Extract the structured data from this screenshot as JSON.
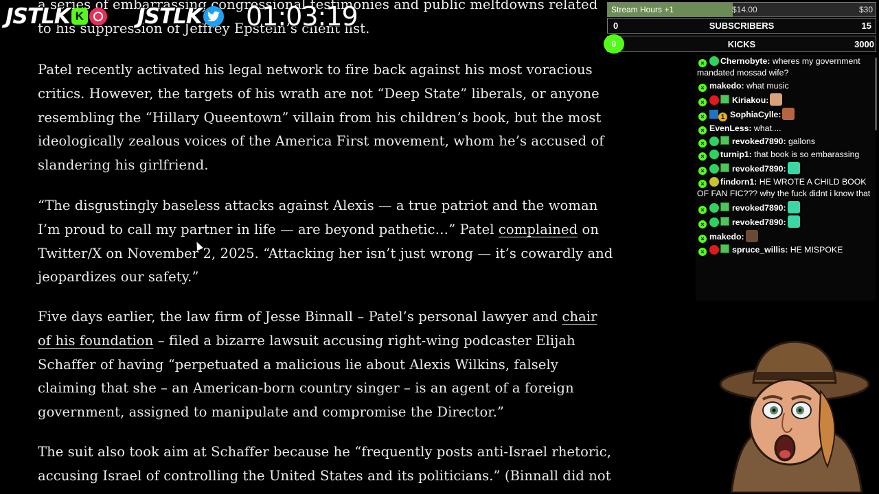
{
  "overlay": {
    "logo1": "JSTLK",
    "logo2": "JSTLK",
    "kick_badge": "K",
    "timer": "01:03:19"
  },
  "goals": {
    "stream_hours_label": "Stream Hours +1",
    "stream_hours_amount": "$14.00",
    "stream_hours_goal": "$30",
    "stream_hours_progress": 0.466,
    "subs_count": "0",
    "subs_label": "SUBSCRIBERS",
    "subs_goal": "15",
    "kicks_count": "0",
    "kicks_label": "KICKS",
    "kicks_goal": "3000"
  },
  "article": {
    "p0": "a series of embarrassing congressional testimonies and public meltdowns related to his suppression of Jeffrey Epstein’s client list.",
    "p1": "Patel recently activated his legal network to fire back against his most voracious critics. However, the targets of his wrath are not “Deep State” liberals, or anyone resembling the “Hillary Queentown” villain from his children’s book, but the most ideologically zealous voices of the America First movement, whom he’s accused of slandering his girlfriend.",
    "p2_a": "“The disgustingly baseless attacks against Alexis — a true patriot and the woman I’m proud to call my partner in life — are beyond pathetic…” Patel ",
    "p2_link": "complained",
    "p2_b": " on Twitter/X on November 2, 2025. “Attacking her isn’t just wrong — it’s cowardly and jeopardizes our safety.”",
    "p3_a": "Five days earlier, the law firm of Jesse Binnall – Patel’s personal lawyer and ",
    "p3_link": "chair of his foundation",
    "p3_b": " – filed a bizarre lawsuit accusing right-wing podcaster Elijah Schaffer of having “perpetuated a malicious lie about Alexis Wilkins, falsely claiming that she – an American-born country singer – is an agent of a foreign government, assigned to manipulate and compromise the Director.”",
    "p4": "The suit also took aim at Schaffer because he “frequently posts anti-Israel rhetoric, accusing Israel of controlling the United States and its politicians.” (Binnall did not"
  },
  "chat": [
    {
      "user": "Chernobyte:",
      "text": " wheres my government mandated mossad wife?"
    },
    {
      "user": "makedo:",
      "text": " what music"
    },
    {
      "user": "Kiriakou:",
      "text": ""
    },
    {
      "user": "SophiaCylle:",
      "text": ""
    },
    {
      "user": "EvenLess:",
      "text": " what...."
    },
    {
      "user": "revoked7890:",
      "text": " gallons"
    },
    {
      "user": "turnip1:",
      "text": " that book is so embarassing"
    },
    {
      "user": "revoked7890:",
      "text": ""
    },
    {
      "user": "findorn1:",
      "text": " HE WROTE A CHILD BOOK OF FAN FIC??? why the fuck didnt i know that"
    },
    {
      "user": "revoked7890:",
      "text": ""
    },
    {
      "user": "revoked7890:",
      "text": ""
    },
    {
      "user": "makedo:",
      "text": ""
    },
    {
      "user": "spruce_willis:",
      "text": " HE MISPOKE"
    }
  ],
  "badges": {
    "chat_badge_label": "×",
    "sub_months": "1"
  },
  "colors": {
    "kick_green": "#53fc18",
    "background": "#000000",
    "text": "#ececec"
  }
}
